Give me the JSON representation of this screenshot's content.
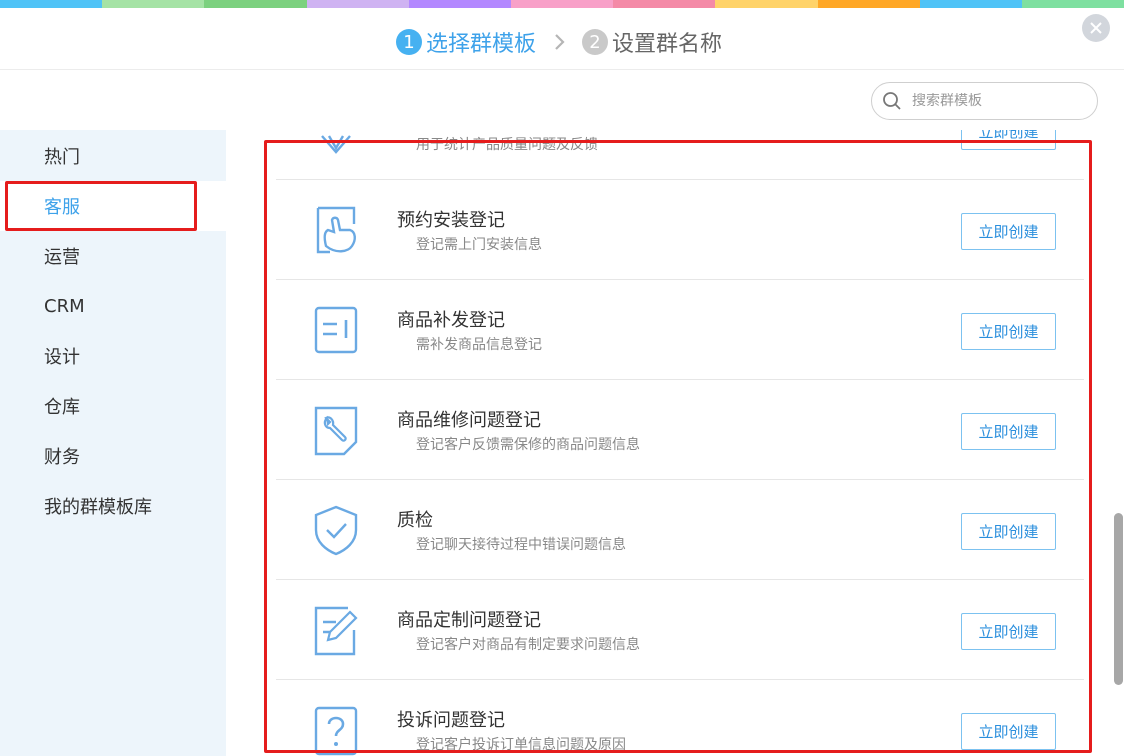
{
  "colors": {
    "accent": "#3ea2ea",
    "sidebar_bg": "#edf5fb",
    "highlight_box": "#e51c1c",
    "rainbow": [
      "#4fc3f7",
      "#a5e3a5",
      "#7cd17f",
      "#cfb3f2",
      "#b388ff",
      "#f8a0c8",
      "#f48aa7",
      "#ffd36a",
      "#ffa726",
      "#4fc3f7",
      "#7ee0a0"
    ]
  },
  "steps": [
    {
      "number": "1",
      "label": "选择群模板",
      "state": "active"
    },
    {
      "number": "2",
      "label": "设置群名称",
      "state": "inactive"
    }
  ],
  "search": {
    "placeholder": "搜索群模板",
    "value": "",
    "icon": "search-icon"
  },
  "sidebar": {
    "items": [
      {
        "label": "热门"
      },
      {
        "label": "客服",
        "active": true
      },
      {
        "label": "运营"
      },
      {
        "label": "CRM"
      },
      {
        "label": "设计"
      },
      {
        "label": "仓库"
      },
      {
        "label": "财务"
      },
      {
        "label": "我的群模板库"
      }
    ]
  },
  "templates": [
    {
      "title": "",
      "desc": "用于统计产品质量问题及反馈",
      "button": "立即创建",
      "icon": "funnel-icon"
    },
    {
      "title": "预约安装登记",
      "desc": "登记需上门安装信息",
      "button": "立即创建",
      "icon": "hand-icon"
    },
    {
      "title": "商品补发登记",
      "desc": "需补发商品信息登记",
      "button": "立即创建",
      "icon": "form-icon"
    },
    {
      "title": "商品维修问题登记",
      "desc": "登记客户反馈需保修的商品问题信息",
      "button": "立即创建",
      "icon": "wrench-icon"
    },
    {
      "title": "质检",
      "desc": "登记聊天接待过程中错误问题信息",
      "button": "立即创建",
      "icon": "shield-check-icon"
    },
    {
      "title": "商品定制问题登记",
      "desc": "登记客户对商品有制定要求问题信息",
      "button": "立即创建",
      "icon": "edit-icon"
    },
    {
      "title": "投诉问题登记",
      "desc": "登记客户投诉订单信息问题及原因",
      "button": "立即创建",
      "icon": "question-icon"
    }
  ]
}
